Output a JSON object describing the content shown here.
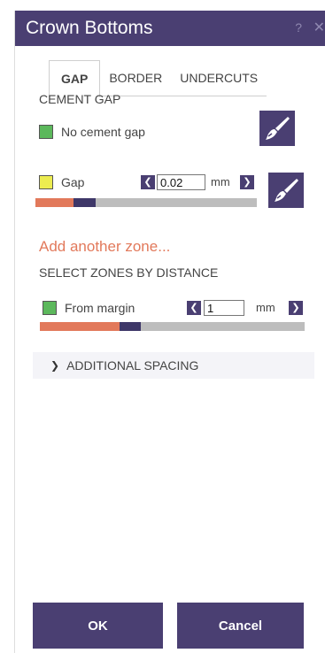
{
  "window": {
    "title": "Crown Bottoms",
    "help_glyph": "?",
    "close_glyph": "✕"
  },
  "tabs": [
    {
      "label": "GAP",
      "active": true
    },
    {
      "label": "BORDER",
      "active": false
    },
    {
      "label": "UNDERCUTS",
      "active": false
    }
  ],
  "cement_gap": {
    "section_title": "CEMENT GAP",
    "no_gap": {
      "label": "No cement gap",
      "color": "#5cb85c"
    },
    "gap": {
      "label": "Gap",
      "color": "#ecec50",
      "value": "0.02",
      "unit": "mm",
      "bar_fill_red": 0.17,
      "bar_fill_dark": 0.1
    }
  },
  "add_zone_link": "Add another zone...",
  "select_zones": {
    "section_title": "SELECT ZONES BY DISTANCE",
    "from_margin": {
      "label": "From margin",
      "color": "#5cb85c",
      "value": "1",
      "unit": "mm",
      "bar_fill_red": 0.3,
      "bar_fill_dark": 0.08
    }
  },
  "additional_spacing": {
    "label": "ADDITIONAL SPACING",
    "chevron": "❯"
  },
  "buttons": {
    "ok": "OK",
    "cancel": "Cancel"
  },
  "arrows": {
    "left": "❮",
    "right": "❯"
  },
  "colors": {
    "accent": "#4a3f72",
    "link": "#e2795b"
  }
}
